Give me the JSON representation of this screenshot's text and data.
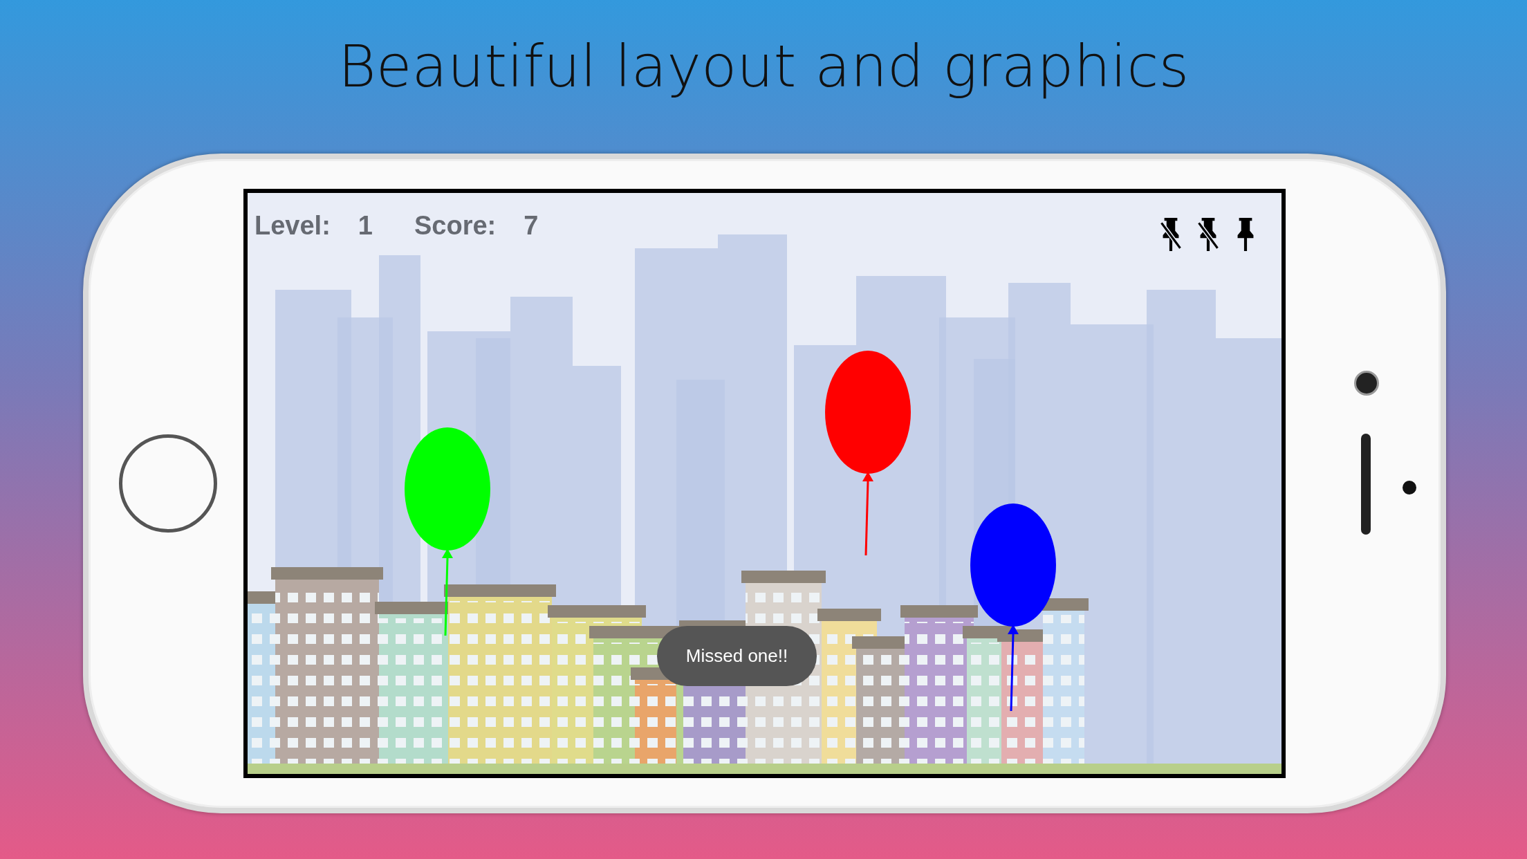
{
  "headline": "Beautiful layout and graphics",
  "hud": {
    "level_label": "Level:",
    "level": "1",
    "score_label": "Score:",
    "score": "7"
  },
  "lives": [
    {
      "lost": true
    },
    {
      "lost": true
    },
    {
      "lost": false
    }
  ],
  "balloons": [
    {
      "color": "#00ff00"
    },
    {
      "color": "#ff0000"
    },
    {
      "color": "#0000ff"
    }
  ],
  "toast": "Missed one!!"
}
